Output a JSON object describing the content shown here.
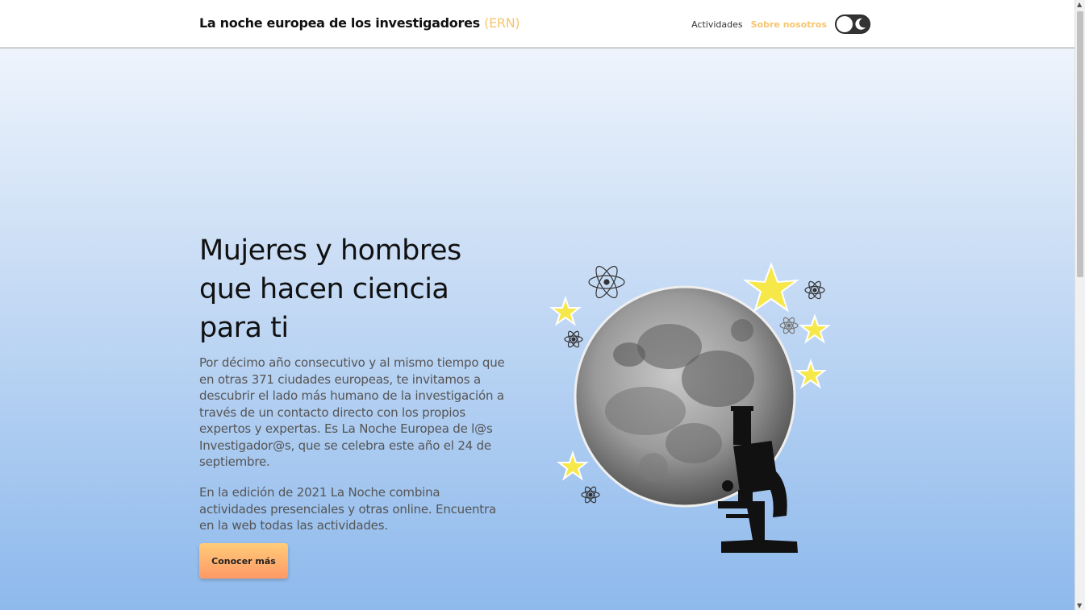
{
  "header": {
    "brand": "La noche europea de los investigadores",
    "brand_accent": "(ERN)",
    "nav": [
      {
        "label": "Actividades"
      },
      {
        "label": "Sobre nosotros"
      }
    ],
    "theme_toggle_icon": "moon-icon"
  },
  "hero": {
    "title": "Mujeres y hombres que hacen ciencia para ti",
    "paragraph1": "Por décimo año consecutivo y al mismo tiempo que en otras 371 ciudades europeas, te invitamos a descubrir el lado más humano de la investigación a través de un contacto directo con los propios expertos y expertas. Es La Noche Europea de l@s Investigador@s, que se celebra este año el 24 de septiembre.",
    "paragraph2": "En la edición de 2021 La Noche combina actividades presenciales y otras online. Encuentra en la web todas las actividades.",
    "cta": "Conocer más"
  },
  "colors": {
    "accent": "#f7c56e",
    "button_top": "#ffcc7a",
    "button_bottom": "#ff9966",
    "gradient_top": "#eef4fc",
    "gradient_bottom": "#8db9ec"
  },
  "illustration": {
    "icons": [
      "moon-image",
      "microscope-icon",
      "star-icon",
      "atom-icon"
    ]
  }
}
